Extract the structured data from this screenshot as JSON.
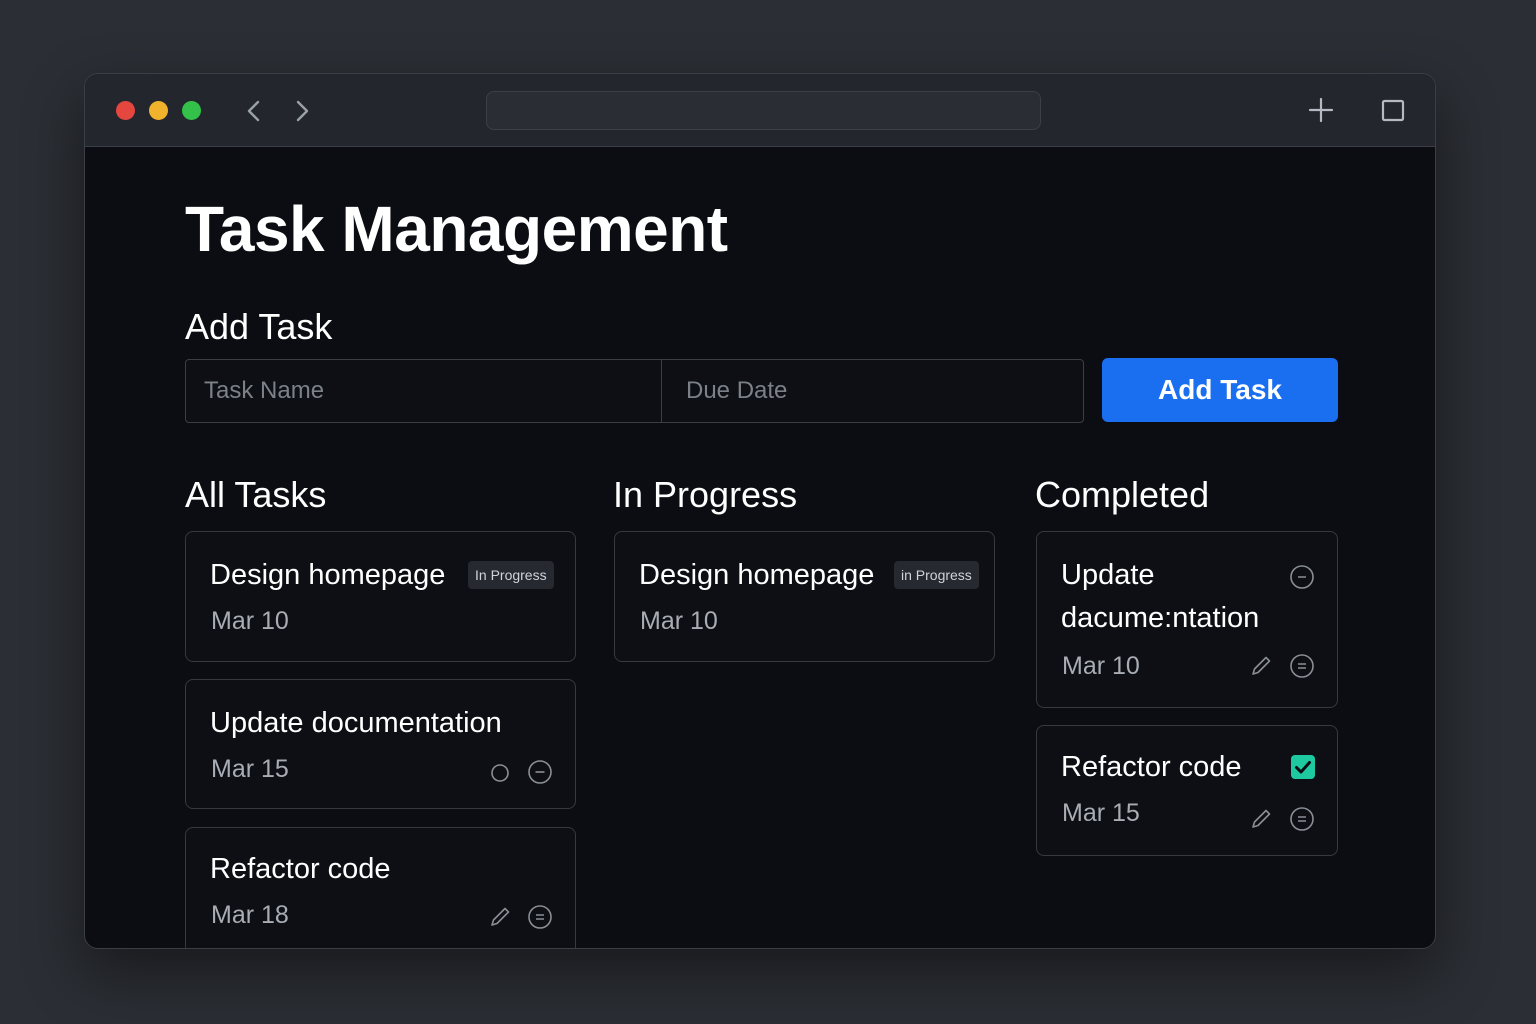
{
  "page": {
    "title": "Task Management",
    "add_section_label": "Add Task"
  },
  "form": {
    "task_name_placeholder": "Task Name",
    "due_date_placeholder": "Due Date",
    "submit_label": "Add Task"
  },
  "columns": {
    "all": {
      "heading": "All Tasks",
      "cards": [
        {
          "title": "Design homepage",
          "date": "Mar 10",
          "badge": "In Progress"
        },
        {
          "title": "Update documentation",
          "date": "Mar 15"
        },
        {
          "title": "Refactor code",
          "date": "Mar 18"
        }
      ]
    },
    "in_progress": {
      "heading": "In Progress",
      "cards": [
        {
          "title": "Design homepage",
          "date": "Mar 10",
          "badge": "in Progress"
        }
      ]
    },
    "completed": {
      "heading": "Completed",
      "cards": [
        {
          "title_line1": "Update",
          "title_line2": "dacume:ntation",
          "date": "Mar 10"
        },
        {
          "title": "Refactor code",
          "date": "Mar 15",
          "checked": true
        }
      ]
    }
  },
  "colors": {
    "accent": "#1a6ef0",
    "check": "#1ec9a0",
    "window_bg": "#0b0d12"
  },
  "icons": {
    "titlebar": [
      "back-arrow-icon",
      "forward-arrow-icon",
      "new-tab-plus-icon",
      "tab-overview-icon"
    ],
    "card_actions": [
      "circle-icon",
      "minus-circle-icon",
      "pencil-icon",
      "equals-circle-icon",
      "checkbox-checked-icon"
    ]
  }
}
